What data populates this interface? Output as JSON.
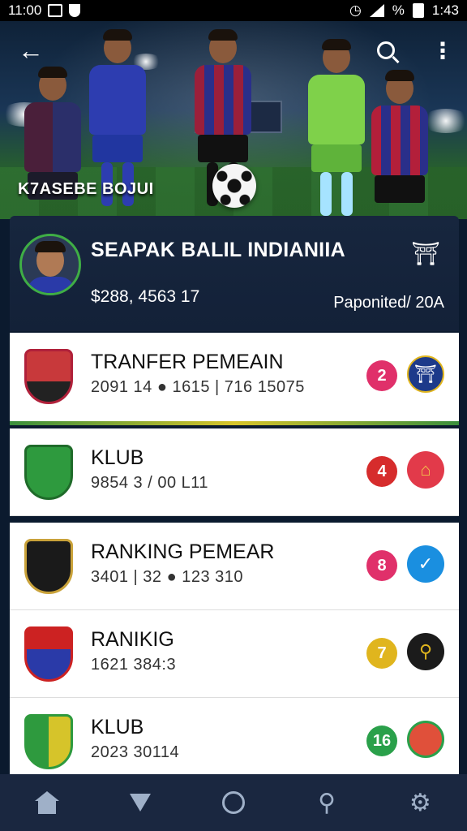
{
  "status_bar": {
    "time_left": "11:00",
    "battery_percent": "%",
    "time_right": "1:43"
  },
  "hero": {
    "caption": "K7ASEBE BOJUI",
    "back_icon": "arrow-left-icon",
    "search_icon": "search-icon",
    "more_icon": "more-vertical-icon"
  },
  "profile": {
    "title": "SEAPAK BALIL INDIANIIA",
    "stats": "$288, 4563 17",
    "meta": "Paponited/ 20A",
    "badge_icon": "shield-icon"
  },
  "items": [
    {
      "title": "TRANFER PEMEAIN",
      "subtitle": "2091   14  ● 1615 | 716 15075",
      "count": "2",
      "count_color": "#e0306a",
      "action_color": "#1d3a8a",
      "action_icon": "club-crest-icon"
    },
    {
      "title": "KLUB",
      "subtitle": "9854  3 / 00              L11",
      "count": "4",
      "count_color": "#d62c2c",
      "action_color": "#e23a4a",
      "action_icon": "house-icon"
    },
    {
      "title": "RANKING PEMEAR",
      "subtitle": "3401 | 32  ● 123     310",
      "count": "8",
      "count_color": "#e0306a",
      "action_color": "#1a8fe0",
      "action_icon": "check-icon"
    },
    {
      "title": "RANIKIG",
      "subtitle": "1621  384:3",
      "count": "7",
      "count_color": "#e0b51e",
      "action_color": "#1b1b1b",
      "action_icon": "key-icon"
    },
    {
      "title": "KLUB",
      "subtitle": "2023  30114",
      "count": "16",
      "count_color": "#2aa04a",
      "action_color": "#e0503a",
      "action_icon": "circle-icon"
    }
  ],
  "nav": [
    {
      "icon": "home-icon"
    },
    {
      "icon": "triangle-icon"
    },
    {
      "icon": "circle-icon"
    },
    {
      "icon": "person-icon"
    },
    {
      "icon": "settings-icon"
    }
  ]
}
